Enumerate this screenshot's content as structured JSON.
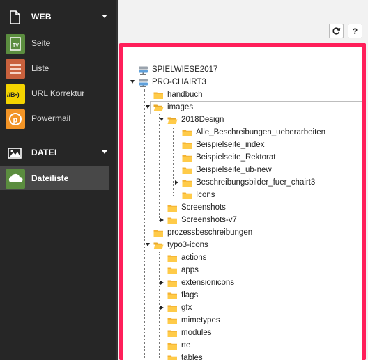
{
  "sidebar": {
    "groups": [
      {
        "label": "WEB",
        "icon": "page-icon"
      },
      {
        "label": "DATEI",
        "icon": "image-icon"
      }
    ],
    "web_items": [
      {
        "label": "Seite",
        "icon": "page-module-icon",
        "color": "#5b8d3f"
      },
      {
        "label": "Liste",
        "icon": "list-module-icon",
        "color": "#c8613d"
      },
      {
        "label": "URL Korrektur",
        "icon": "url-correction-icon",
        "color": "#f4d400"
      },
      {
        "label": "Powermail",
        "icon": "powermail-icon",
        "color": "#f29426"
      }
    ],
    "datei_items": [
      {
        "label": "Dateiliste",
        "icon": "filelist-module-icon",
        "color": "#5b8d3f",
        "active": true
      }
    ]
  },
  "toolbar": {
    "refresh_icon": "refresh-icon",
    "help_label": "?"
  },
  "tree": {
    "highlight_color": "#ff1f5a",
    "nodes": [
      {
        "label": "SPIELWIESE2017",
        "type": "storage"
      },
      {
        "label": "PRO-CHAIRT3",
        "type": "storage"
      },
      {
        "label": "handbuch",
        "type": "folder"
      },
      {
        "label": "images",
        "type": "folder",
        "selected": true
      },
      {
        "label": "2018Design",
        "type": "folder"
      },
      {
        "label": "Alle_Beschreibungen_ueberarbeiten",
        "type": "folder"
      },
      {
        "label": "Beispielseite_index",
        "type": "folder"
      },
      {
        "label": "Beispielseite_Rektorat",
        "type": "folder"
      },
      {
        "label": "Beispielseite_ub-new",
        "type": "folder"
      },
      {
        "label": "Beschreibungsbilder_fuer_chairt3",
        "type": "folder"
      },
      {
        "label": "Icons",
        "type": "folder"
      },
      {
        "label": "Screenshots",
        "type": "folder"
      },
      {
        "label": "Screenshots-v7",
        "type": "folder"
      },
      {
        "label": "prozessbeschreibungen",
        "type": "folder"
      },
      {
        "label": "typo3-icons",
        "type": "folder"
      },
      {
        "label": "actions",
        "type": "folder"
      },
      {
        "label": "apps",
        "type": "folder"
      },
      {
        "label": "extensionicons",
        "type": "folder"
      },
      {
        "label": "flags",
        "type": "folder"
      },
      {
        "label": "gfx",
        "type": "folder"
      },
      {
        "label": "mimetypes",
        "type": "folder"
      },
      {
        "label": "modules",
        "type": "folder"
      },
      {
        "label": "rte",
        "type": "folder"
      },
      {
        "label": "tables",
        "type": "folder"
      }
    ]
  }
}
